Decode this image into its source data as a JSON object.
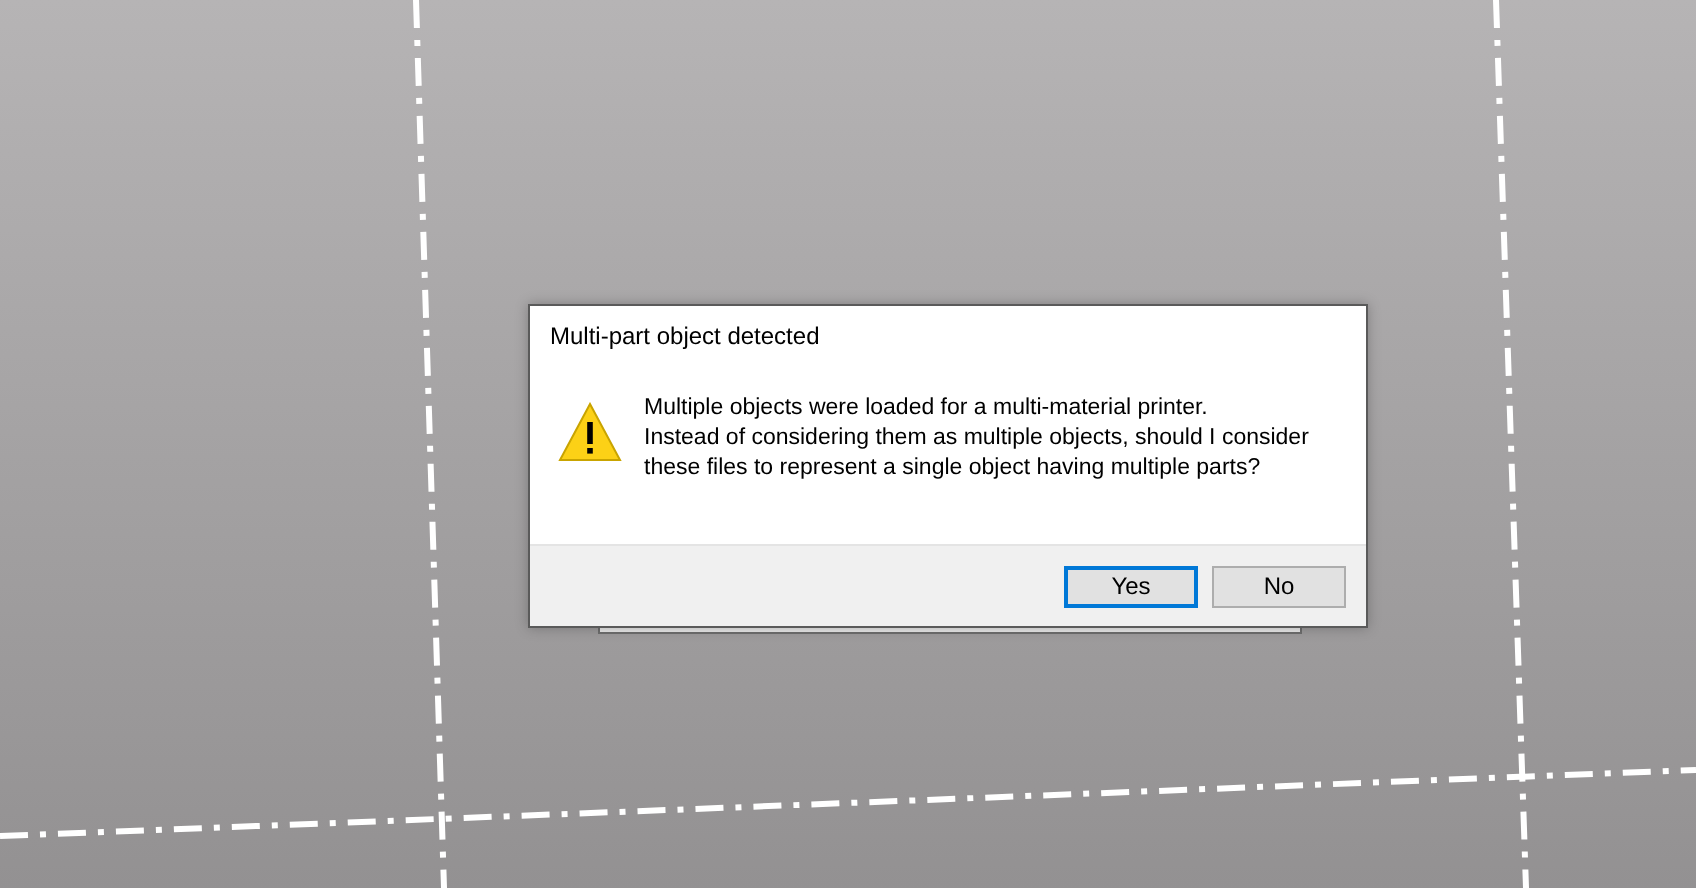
{
  "dialog": {
    "title": "Multi-part object detected",
    "kind": "warning",
    "message": "Multiple objects were loaded for a multi-material printer.\nInstead of considering them as multiple objects, should I consider\nthese files to represent a single object having multiple parts?",
    "buttons": [
      {
        "label": "Yes",
        "selected": true
      },
      {
        "label": "No",
        "selected": false
      }
    ]
  }
}
